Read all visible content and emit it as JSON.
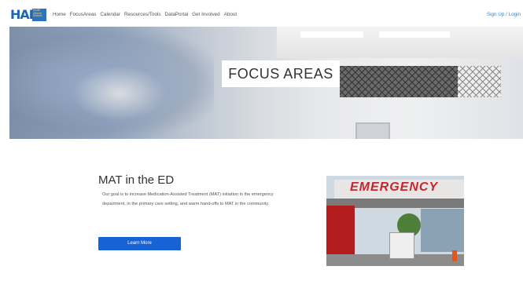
{
  "header": {
    "logo_text": "HAP",
    "logo_subtext": "Health Alliance Network",
    "nav": [
      "Home",
      "FocusAreas",
      "Calendar",
      "Resources/Tools",
      "DataPortal",
      "Get Involved",
      "About"
    ],
    "signup": "Sign Up / Login"
  },
  "hero": {
    "title": "FOCUS AREAS"
  },
  "section": {
    "title": "MAT in the ED",
    "text": "Our goal is to increase Medication-Assisted Treatment (MAT) initiation in the emergency department, in the primary care setting, and warm hand-offs to MAT in the community.",
    "button": "Learn More",
    "image_sign": "EMERGENCY"
  }
}
